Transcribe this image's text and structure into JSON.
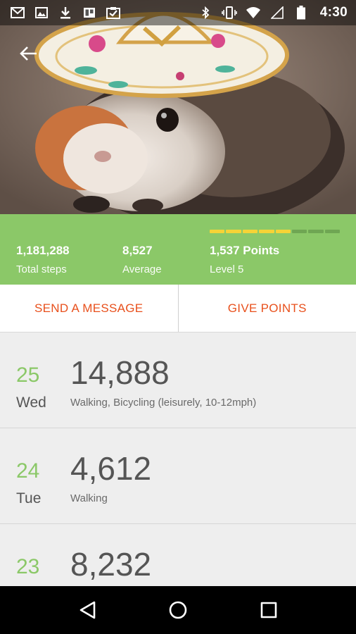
{
  "status_bar": {
    "time": "4:30",
    "left_icons": [
      "mail-icon",
      "image-icon",
      "download-icon",
      "trello-icon",
      "clipboard-check-icon"
    ],
    "right_icons": [
      "bluetooth-icon",
      "vibrate-icon",
      "wifi-icon",
      "signal-icon",
      "battery-icon"
    ]
  },
  "hero": {
    "back_icon": "arrow-back-icon",
    "photo": "guinea pig wearing a sombrero"
  },
  "stats": {
    "total_steps": {
      "value": "1,181,288",
      "label": "Total steps"
    },
    "average": {
      "value": "8,527",
      "label": "Average"
    },
    "points": {
      "value": "1,537 Points",
      "label": "Level 5"
    },
    "level_progress_segments": {
      "filled": 5,
      "total": 8
    },
    "colors": {
      "bar": "#8bc868",
      "progress_filled": "#f5d337",
      "progress_empty": "#6fa653"
    }
  },
  "actions": {
    "send_message": "SEND A MESSAGE",
    "give_points": "GIVE POINTS",
    "accent": "#e8501c"
  },
  "days": [
    {
      "date": "25",
      "dow": "Wed",
      "steps": "14,888",
      "activities": "Walking, Bicycling (leisurely, 10-12mph)"
    },
    {
      "date": "24",
      "dow": "Tue",
      "steps": "4,612",
      "activities": "Walking"
    },
    {
      "date": "23",
      "dow": "",
      "steps": "8,232",
      "activities": ""
    }
  ],
  "nav": {
    "back": "triangle-back-icon",
    "home": "circle-home-icon",
    "recents": "square-recents-icon"
  }
}
